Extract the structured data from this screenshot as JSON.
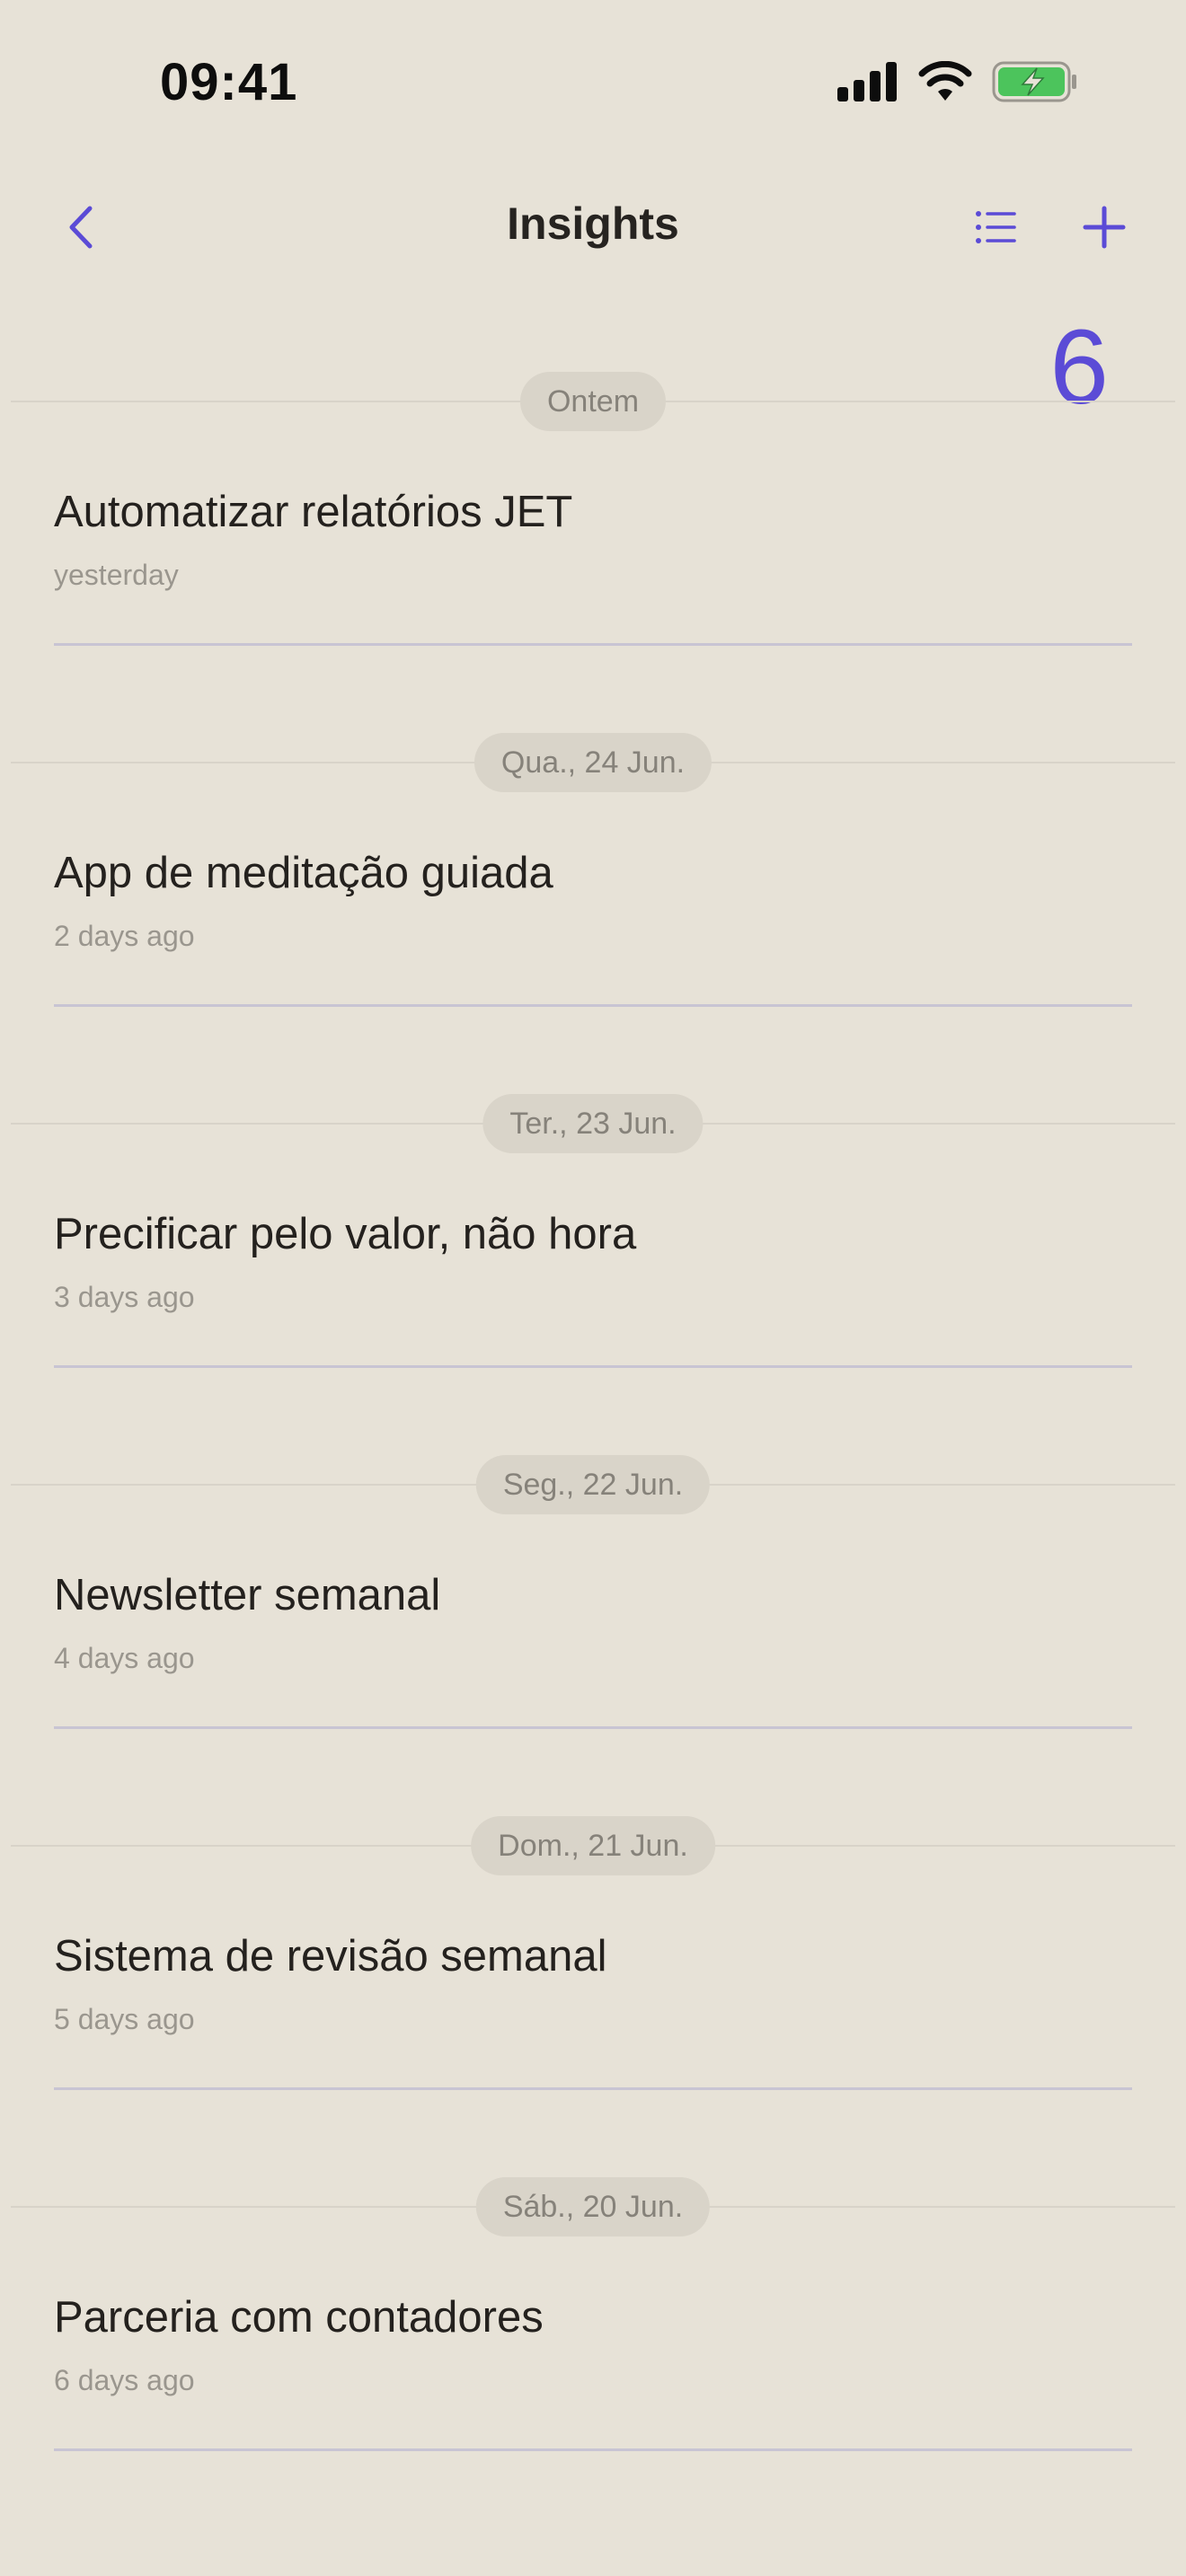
{
  "status_bar": {
    "time": "09:41",
    "icons": [
      "cellular-signal-icon",
      "wifi-icon",
      "battery-charging-icon"
    ]
  },
  "nav": {
    "title": "Insights",
    "back_icon": "chevron-left-icon",
    "list_icon": "list-icon",
    "add_icon": "plus-icon"
  },
  "count": "6",
  "colors": {
    "background": "#e7e2d7",
    "accent": "#5b4bd6",
    "pill": "#d9d4c9",
    "battery": "#4cc45c"
  },
  "entries": [
    {
      "date": "Ontem",
      "title": "Automatizar relatórios JET",
      "subtitle": "yesterday"
    },
    {
      "date": "Qua., 24 Jun.",
      "title": "App de meditação guiada",
      "subtitle": "2 days ago"
    },
    {
      "date": "Ter., 23 Jun.",
      "title": "Precificar pelo valor, não hora",
      "subtitle": "3 days ago"
    },
    {
      "date": "Seg., 22 Jun.",
      "title": "Newsletter semanal",
      "subtitle": "4 days ago"
    },
    {
      "date": "Dom., 21 Jun.",
      "title": "Sistema de revisão semanal",
      "subtitle": "5 days ago"
    },
    {
      "date": "Sáb., 20 Jun.",
      "title": "Parceria com contadores",
      "subtitle": "6 days ago"
    }
  ]
}
